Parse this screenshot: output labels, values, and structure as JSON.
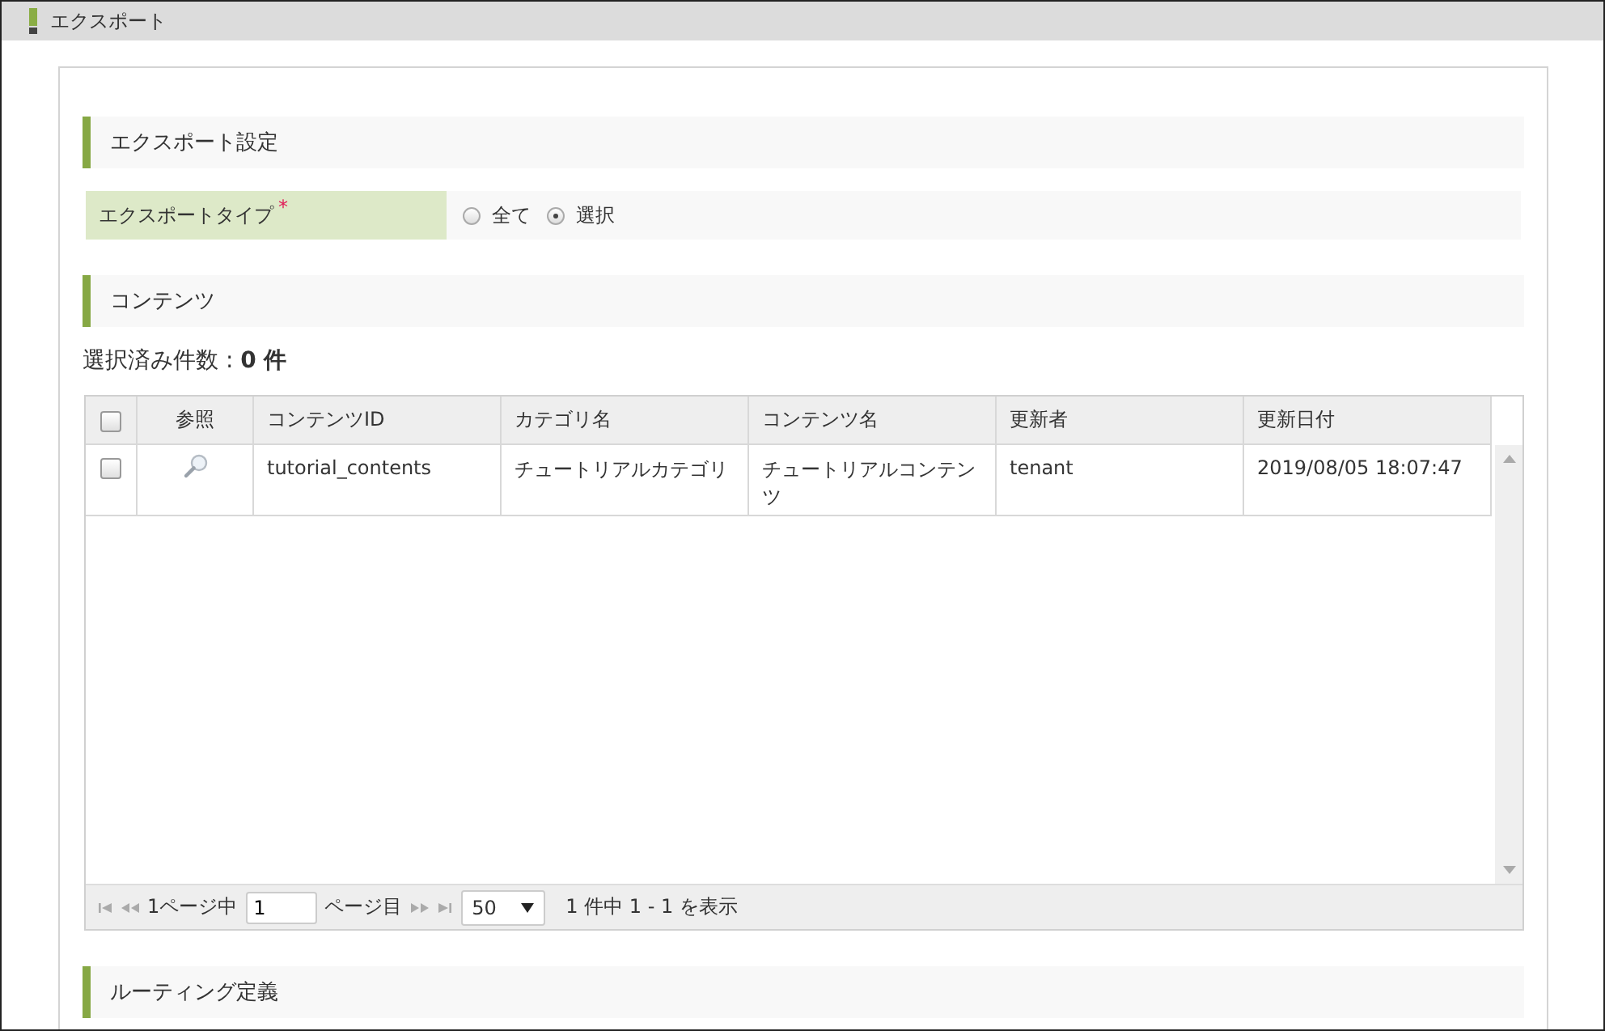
{
  "window": {
    "title": "エクスポート"
  },
  "sections": [
    {
      "title": "エクスポート設定"
    },
    {
      "title": "コンテンツ"
    },
    {
      "title": "ルーティング定義"
    }
  ],
  "export_type": {
    "label": "エクスポートタイプ",
    "required_mark": "*",
    "options": [
      {
        "label": "全て",
        "selected": false
      },
      {
        "label": "選択",
        "selected": true
      }
    ]
  },
  "selected_count": "選択済み件数 : **0 件**",
  "table": {
    "columns": [
      "",
      "参照",
      "コンテンツID",
      "カテゴリ名",
      "コンテンツ名",
      "更新者",
      "更新日付"
    ],
    "header_checked": false,
    "rows": [
      {
        "checked": false,
        "cells": [
          "",
          "",
          "tutorial_contents",
          "チュートリアルカテゴリ",
          "チュートリアルコンテンツ",
          "tenant",
          "2019/08/05 18:07:47"
        ]
      }
    ]
  },
  "pager": {
    "of_pages": "1ページ中",
    "page": "1",
    "page_suffix": "ページ目",
    "page_size": "50",
    "summary": "1 件中 1 - 1 を表示"
  }
}
